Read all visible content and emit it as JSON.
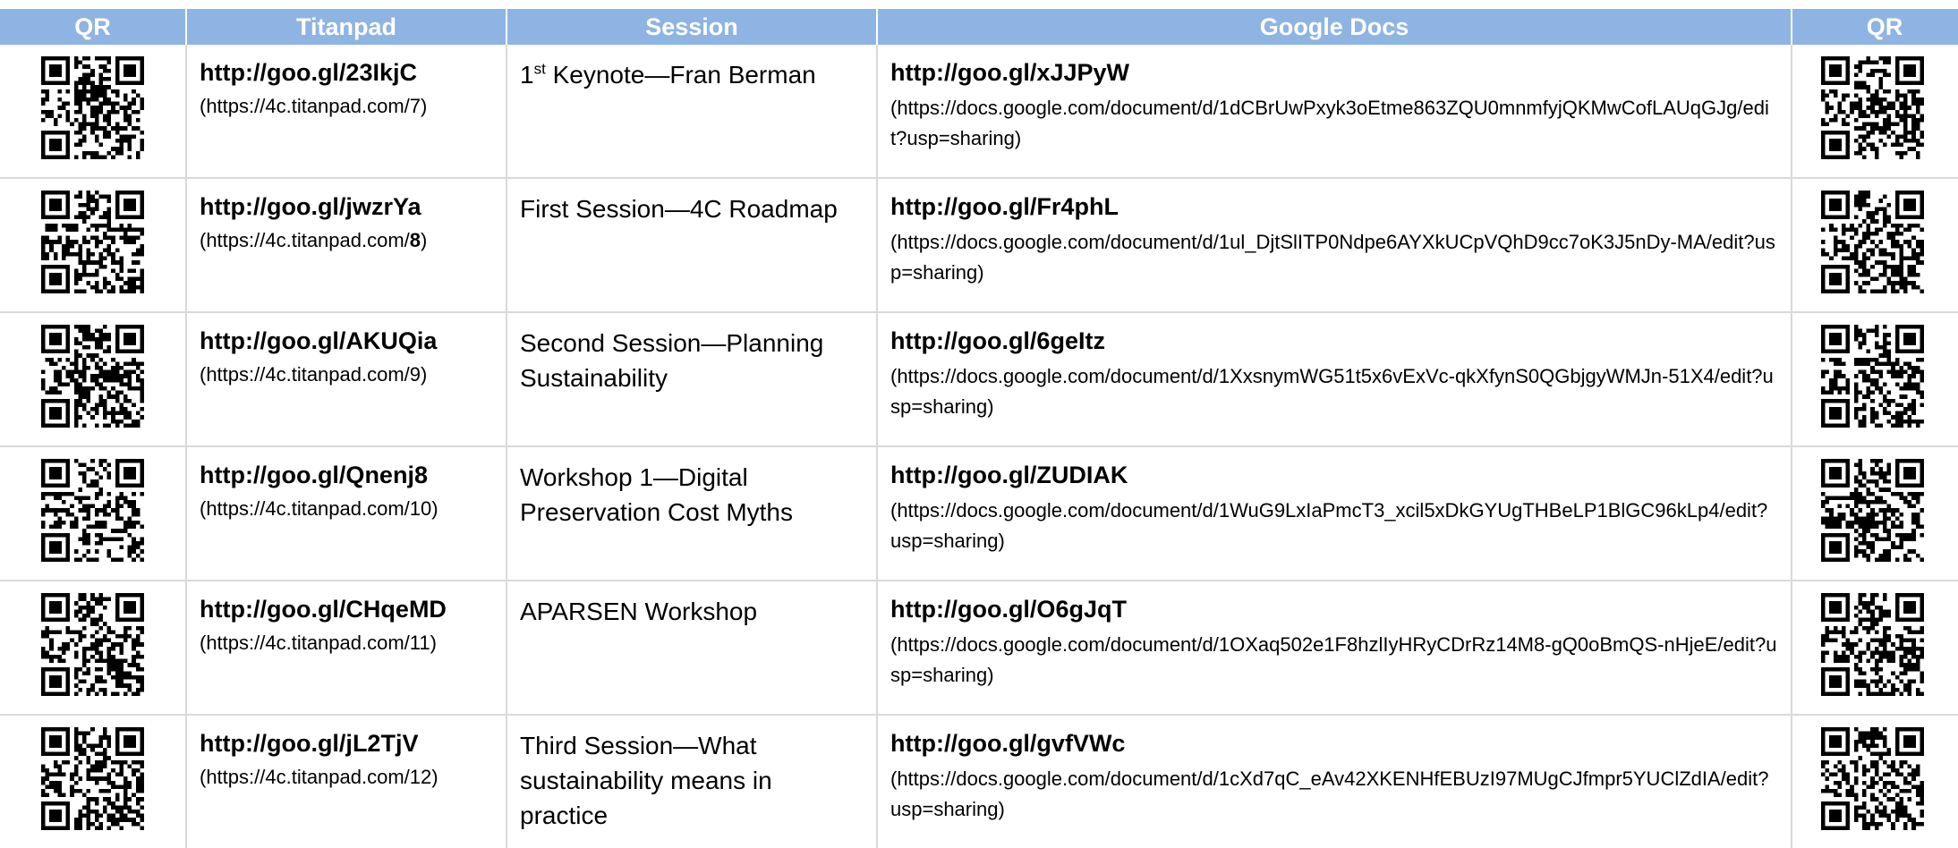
{
  "headers": [
    "QR",
    "Titanpad",
    "Session",
    "Google Docs",
    "QR"
  ],
  "rows": [
    {
      "titanpad_short": "http://goo.gl/23IkjC",
      "titanpad_prefix": "(https://4c.titanpad.com/",
      "titanpad_num": "7",
      "titanpad_suffix": ")",
      "titanpad_num_bold": false,
      "session_pre": "1",
      "session_sup": "st",
      "session_text": " Keynote—Fran Berman",
      "docs_short": "http://goo.gl/xJJPyW",
      "docs_long": "(https://docs.google.com/document/d/1dCBrUwPxyk3oEtme863ZQU0mnmfyjQKMwCofLAUqGJg/edit?usp=sharing)"
    },
    {
      "titanpad_short": "http://goo.gl/jwzrYa",
      "titanpad_prefix": "(https://4c.titanpad.com/",
      "titanpad_num": "8",
      "titanpad_suffix": ")",
      "titanpad_num_bold": true,
      "session_pre": "",
      "session_sup": "",
      "session_text": "First Session—4C Roadmap",
      "docs_short": "http://goo.gl/Fr4phL",
      "docs_long": "(https://docs.google.com/document/d/1ul_DjtSlITP0Ndpe6AYXkUCpVQhD9cc7oK3J5nDy-MA/edit?usp=sharing)"
    },
    {
      "titanpad_short": "http://goo.gl/AKUQia",
      "titanpad_prefix": "(https://4c.titanpad.com/",
      "titanpad_num": "9",
      "titanpad_suffix": ")",
      "titanpad_num_bold": false,
      "session_pre": "",
      "session_sup": "",
      "session_text": "Second Session—Planning Sustainability",
      "docs_short": "http://goo.gl/6geItz",
      "docs_long": "(https://docs.google.com/document/d/1XxsnymWG51t5x6vExVc-qkXfynS0QGbjgyWMJn-51X4/edit?usp=sharing)"
    },
    {
      "titanpad_short": "http://goo.gl/Qnenj8",
      "titanpad_prefix": "(https://4c.titanpad.com/",
      "titanpad_num": "10",
      "titanpad_suffix": ")",
      "titanpad_num_bold": false,
      "session_pre": "",
      "session_sup": "",
      "session_text": "Workshop 1—Digital Preservation Cost Myths",
      "docs_short": "http://goo.gl/ZUDIAK",
      "docs_long": "(https://docs.google.com/document/d/1WuG9LxIaPmcT3_xcil5xDkGYUgTHBeLP1BlGC96kLp4/edit?usp=sharing)"
    },
    {
      "titanpad_short": "http://goo.gl/CHqeMD",
      "titanpad_prefix": "(https://4c.titanpad.com/",
      "titanpad_num": "11",
      "titanpad_suffix": ")",
      "titanpad_num_bold": false,
      "session_pre": "",
      "session_sup": "",
      "session_text": "APARSEN Workshop",
      "docs_short": "http://goo.gl/O6gJqT",
      "docs_long": "(https://docs.google.com/document/d/1OXaq502e1F8hzlIyHRyCDrRz14M8-gQ0oBmQS-nHjeE/edit?usp=sharing)"
    },
    {
      "titanpad_short": "http://goo.gl/jL2TjV",
      "titanpad_prefix": "(https://4c.titanpad.com/",
      "titanpad_num": "12",
      "titanpad_suffix": ")",
      "titanpad_num_bold": false,
      "session_pre": "",
      "session_sup": "",
      "session_text": "Third Session—What sustainability means in practice",
      "docs_short": "http://goo.gl/gvfVWc",
      "docs_long": "(https://docs.google.com/document/d/1cXd7qC_eAv42XKENHfEBUzI97MUgCJfmpr5YUClZdIA/edit?usp=sharing)"
    }
  ],
  "colors": {
    "header_bg": "#8eb4e3",
    "header_text": "#ffffff",
    "grid_line": "#d9d9d9"
  },
  "icons": {
    "qr_code": "qr-code-icon"
  }
}
